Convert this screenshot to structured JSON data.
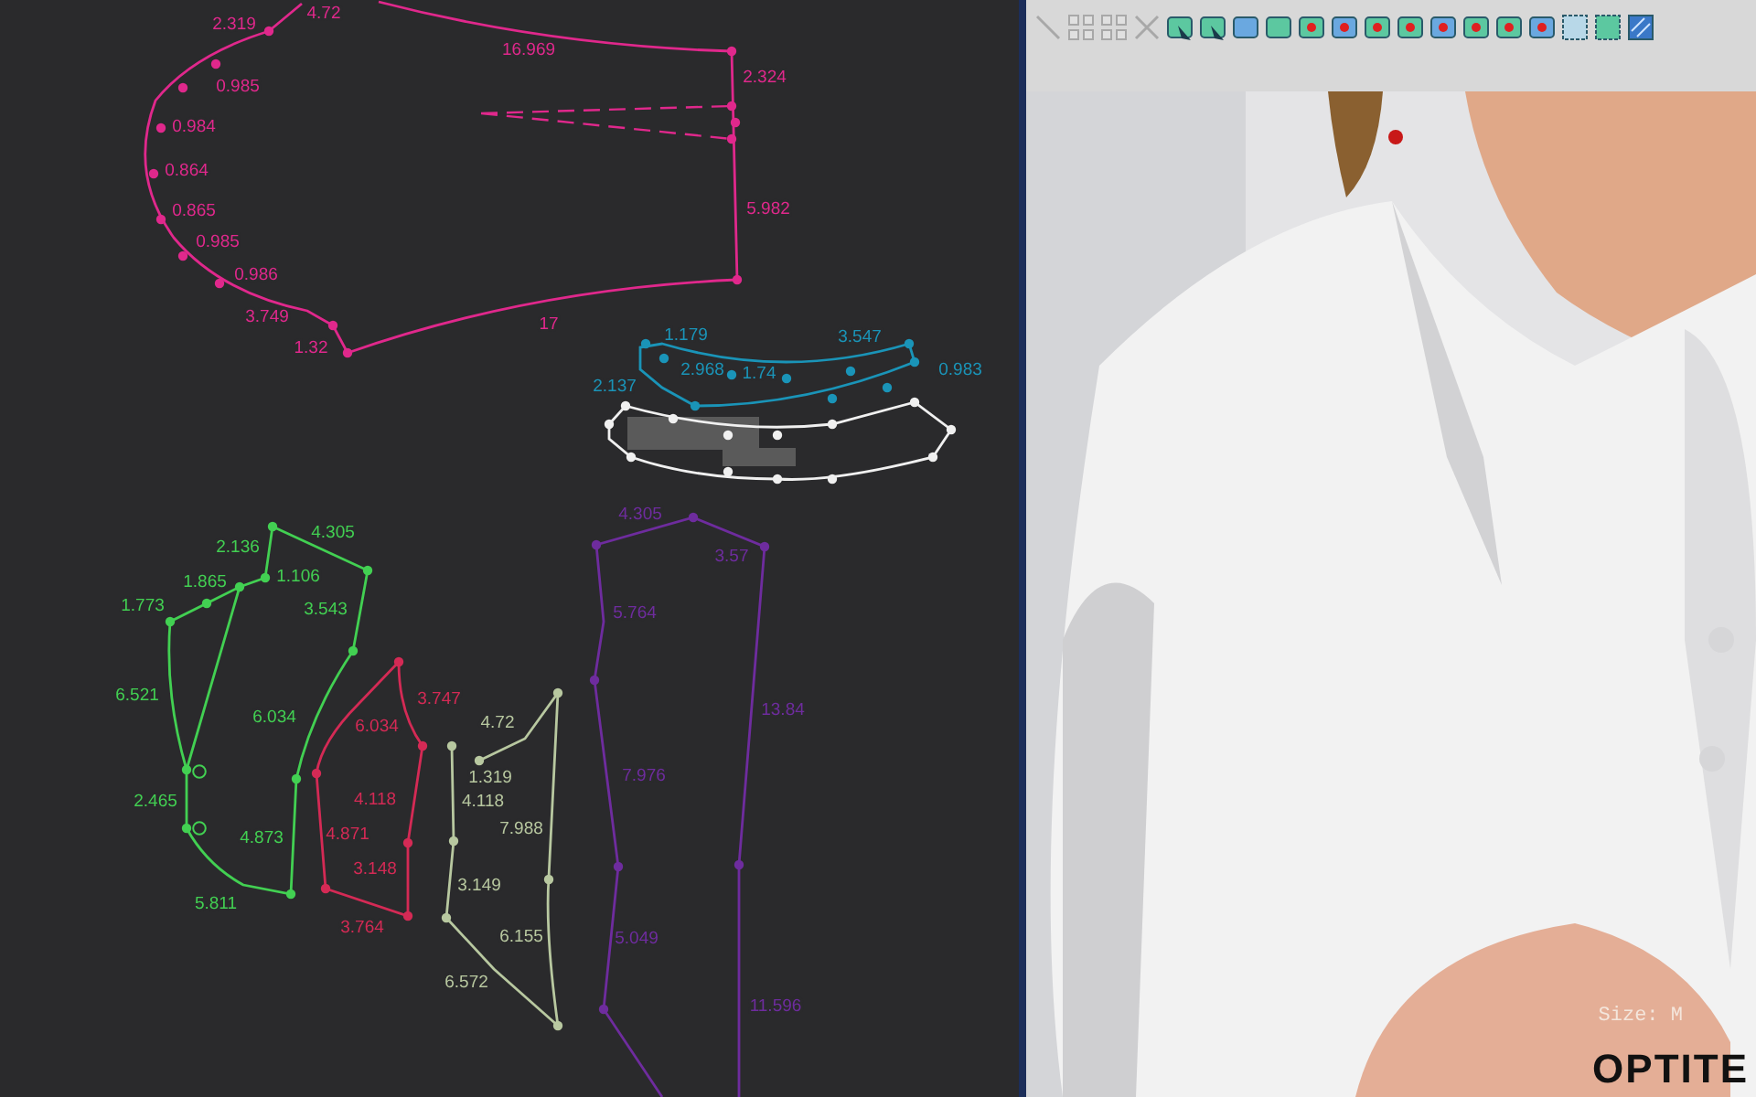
{
  "pattern_pieces": [
    {
      "color": "#e0288c",
      "labels": [
        "4.72",
        "2.319",
        "0.985",
        "0.984",
        "0.864",
        "0.865",
        "0.985",
        "0.986",
        "3.749",
        "1.32",
        "16.969",
        "2.324",
        "5.982",
        "17"
      ]
    },
    {
      "color": "#1a94b8",
      "labels": [
        "1.179",
        "2.968",
        "1.74",
        "2.137",
        "3.547",
        "0.983"
      ]
    },
    {
      "color": "#f0f0f0"
    },
    {
      "color": "#42d052",
      "labels": [
        "2.136",
        "4.305",
        "1.106",
        "1.865",
        "1.773",
        "6.521",
        "2.465",
        "5.811",
        "3.543",
        "6.034",
        "4.873"
      ]
    },
    {
      "color": "#d42a55",
      "labels": [
        "6.034",
        "3.747",
        "4.118",
        "4.871",
        "3.148",
        "3.764"
      ]
    },
    {
      "color": "#b8c8a0",
      "labels": [
        "4.72",
        "1.319",
        "4.118",
        "7.988",
        "3.149",
        "6.155",
        "6.572"
      ]
    },
    {
      "color": "#6e2c9e",
      "labels": [
        "4.305",
        "3.57",
        "5.764",
        "13.84",
        "7.976",
        "5.049",
        "11.596"
      ]
    }
  ],
  "toolbar_buttons": [
    {
      "disabled": true
    },
    {
      "disabled": true
    },
    {
      "disabled": true
    },
    {
      "disabled": true
    },
    {
      "disabled": false
    },
    {
      "disabled": false
    },
    {
      "disabled": false
    },
    {
      "disabled": false
    },
    {
      "disabled": false
    },
    {
      "disabled": false
    },
    {
      "disabled": false
    },
    {
      "disabled": false
    },
    {
      "disabled": false
    },
    {
      "disabled": false
    },
    {
      "disabled": false
    },
    {
      "disabled": false
    },
    {
      "disabled": false
    },
    {
      "disabled": false
    },
    {
      "disabled": false
    }
  ],
  "view": {
    "size_label": "Size: M",
    "logo": "OPTITE"
  }
}
